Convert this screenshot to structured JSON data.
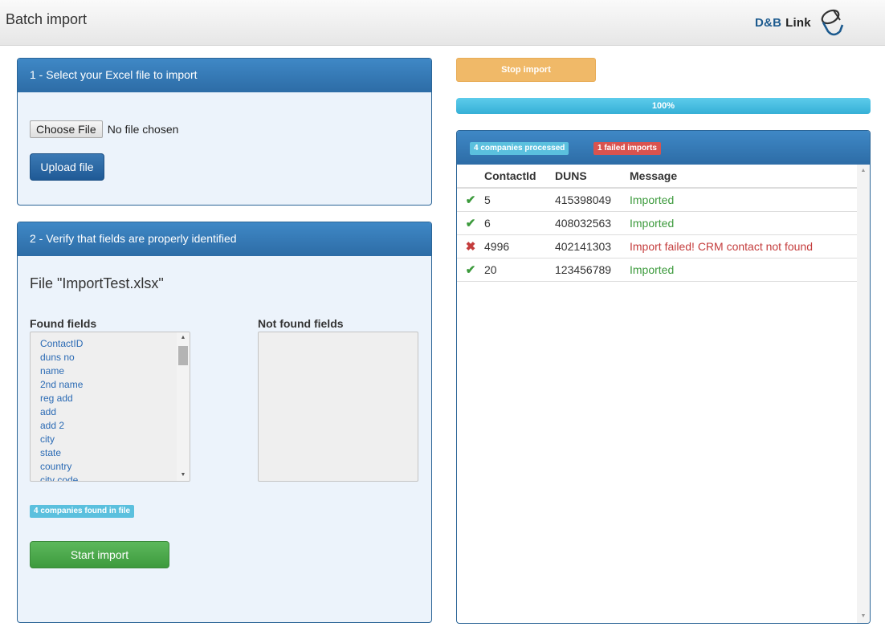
{
  "header": {
    "title": "Batch import",
    "logo_brand": "D&B",
    "logo_product": "Link"
  },
  "step1": {
    "title": "1 - Select your Excel file to import",
    "choose_file_label": "Choose File",
    "file_status": "No file chosen",
    "upload_label": "Upload file"
  },
  "step2": {
    "title": "2 - Verify that fields are properly identified",
    "file_label": "File \"ImportTest.xlsx\"",
    "found_label": "Found fields",
    "not_found_label": "Not found fields",
    "found_fields": [
      "ContactID",
      "duns no",
      "name",
      "2nd name",
      "reg add",
      "add",
      "add 2",
      "city",
      "state",
      "country",
      "city code"
    ],
    "found_count_badge": "4 companies found in file",
    "start_label": "Start import"
  },
  "controls": {
    "stop_label": "Stop import",
    "progress_text": "100%",
    "progress_value": 1.0
  },
  "results": {
    "processed_badge": "4 companies processed",
    "failed_badge": "1 failed imports",
    "columns": [
      "ContactId",
      "DUNS",
      "Message"
    ],
    "rows": [
      {
        "status": "success",
        "contact_id": "5",
        "duns": "415398049",
        "message": "Imported"
      },
      {
        "status": "success",
        "contact_id": "6",
        "duns": "408032563",
        "message": "Imported"
      },
      {
        "status": "failed",
        "contact_id": "4996",
        "duns": "402141303",
        "message": "Import failed! CRM contact not found"
      },
      {
        "status": "success",
        "contact_id": "20",
        "duns": "123456789",
        "message": "Imported"
      }
    ]
  },
  "colors": {
    "primary": "#2d6ca6",
    "success": "#5cb85c",
    "warning": "#f0b968",
    "info": "#5bc0de",
    "danger": "#d9534f"
  },
  "icons": {
    "success": "check-icon",
    "failed": "x-icon"
  }
}
